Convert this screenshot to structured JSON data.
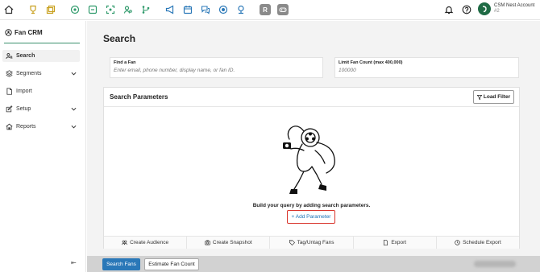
{
  "topbar": {
    "icons": [
      {
        "name": "home-icon",
        "color": "#333333"
      },
      {
        "name": "trophy-icon",
        "color": "#c8a01e"
      },
      {
        "name": "layers-icon",
        "color": "#c8a01e"
      },
      {
        "name": "circle-app-icon",
        "color": "#2f9a6b"
      },
      {
        "name": "square-app-icon",
        "color": "#2f9a6b"
      },
      {
        "name": "scan-icon",
        "color": "#2f9a6b"
      },
      {
        "name": "people-search-icon",
        "color": "#2f9a6b"
      },
      {
        "name": "branch-icon",
        "color": "#2f9a6b"
      },
      {
        "name": "megaphone-icon",
        "color": "#2a78b8"
      },
      {
        "name": "calendar-icon",
        "color": "#2a78b8"
      },
      {
        "name": "chat-icon",
        "color": "#2a78b8"
      },
      {
        "name": "target-icon",
        "color": "#2a78b8"
      },
      {
        "name": "broadcast-icon",
        "color": "#2a78b8"
      },
      {
        "name": "r-app-icon",
        "color": "#8a8a8a",
        "letter": "R"
      },
      {
        "name": "gamepad-icon",
        "color": "#8a8a8a"
      },
      {
        "name": "bell-icon",
        "color": "#333333"
      },
      {
        "name": "help-icon",
        "color": "#333333"
      },
      {
        "name": "account-avatar-icon",
        "color": "#1f6b45"
      }
    ],
    "account_name": "CSM Nest Account",
    "account_sub": "#2"
  },
  "sidebar": {
    "brand": "Fan CRM",
    "items": [
      {
        "label": "Search",
        "icon": "person-search-icon",
        "active": true,
        "has_chevron": false
      },
      {
        "label": "Segments",
        "icon": "segments-icon",
        "active": false,
        "has_chevron": true
      },
      {
        "label": "Import",
        "icon": "file-import-icon",
        "active": false,
        "has_chevron": false
      },
      {
        "label": "Setup",
        "icon": "edit-icon",
        "active": false,
        "has_chevron": true
      },
      {
        "label": "Reports",
        "icon": "reports-icon",
        "active": false,
        "has_chevron": true
      }
    ],
    "collapse_glyph": "⇤"
  },
  "main": {
    "title": "Search",
    "find": {
      "label": "Find a Fan",
      "placeholder": "Enter email, phone number, display name, or fan ID."
    },
    "limit": {
      "label": "Limit Fan Count (max 400,000)",
      "placeholder": "100000"
    },
    "params": {
      "title": "Search Parameters",
      "load_filter": "Load Filter",
      "empty_text": "Build your query by adding search parameters.",
      "add_parameter": "+ Add Parameter"
    },
    "actions": [
      {
        "label": "Create Audience",
        "icon": "audience-icon"
      },
      {
        "label": "Create Snapshot",
        "icon": "camera-icon"
      },
      {
        "label": "Tag/Untag Fans",
        "icon": "tag-icon"
      },
      {
        "label": "Export",
        "icon": "export-icon"
      },
      {
        "label": "Schedule Export",
        "icon": "clock-icon"
      }
    ],
    "bottom": {
      "search_fans": "Search Fans",
      "estimate": "Estimate Fan Count"
    }
  },
  "colors": {
    "accent_green": "#3a8f6c",
    "primary_blue": "#2a78b8",
    "highlight_red": "#d9342b"
  }
}
